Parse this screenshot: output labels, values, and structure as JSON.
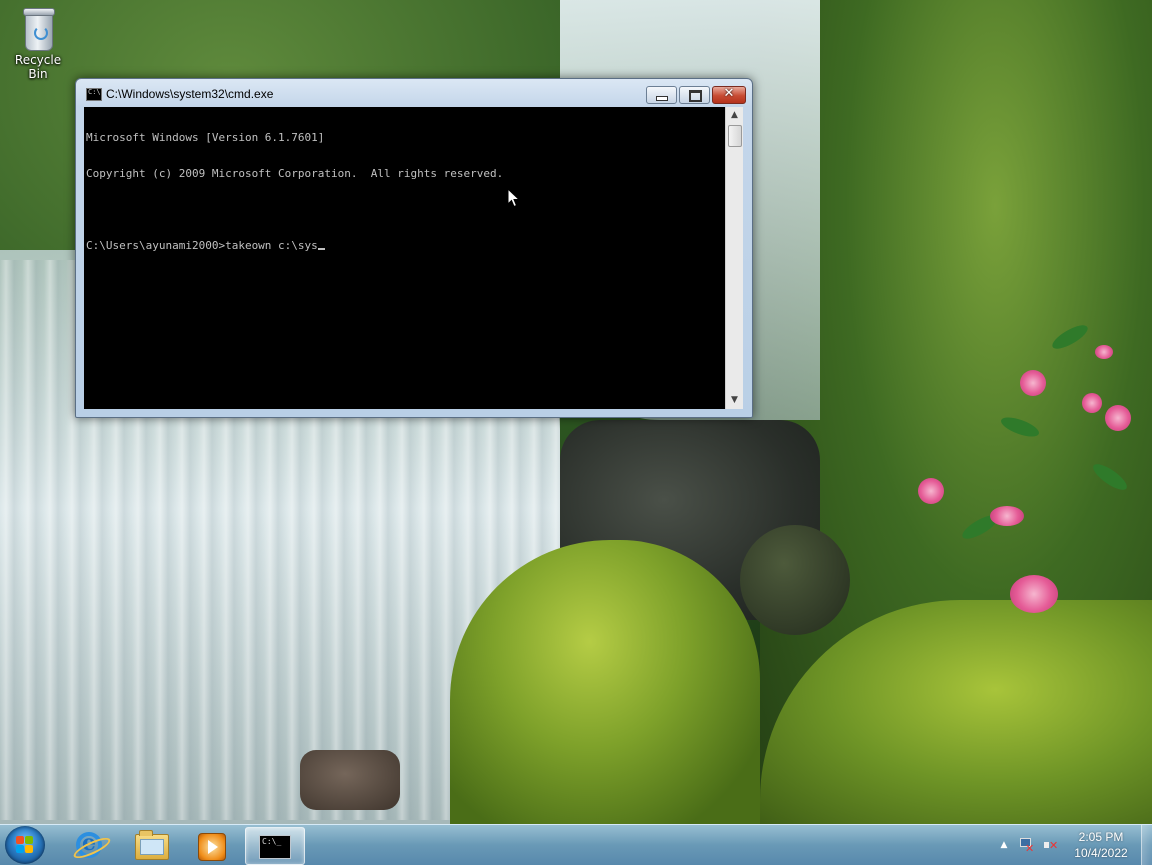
{
  "desktop": {
    "icons": [
      {
        "label": "Recycle Bin",
        "icon": "recycle-bin-icon"
      }
    ]
  },
  "cmd_window": {
    "title": "C:\\Windows\\system32\\cmd.exe",
    "lines": [
      "Microsoft Windows [Version 6.1.7601]",
      "Copyright (c) 2009 Microsoft Corporation.  All rights reserved.",
      "",
      "C:\\Users\\ayunami2000>takeown c:\\sys"
    ],
    "text_color": "#c0c0c0",
    "background_color": "#000000"
  },
  "taskbar": {
    "pinned": [
      {
        "name": "Internet Explorer",
        "icon": "internet-explorer-icon"
      },
      {
        "name": "Windows Explorer",
        "icon": "folder-icon"
      },
      {
        "name": "Windows Media Player",
        "icon": "media-player-icon"
      },
      {
        "name": "Command Prompt",
        "icon": "cmd-icon",
        "active": true
      }
    ],
    "clock": {
      "time": "2:05 PM",
      "date": "10/4/2022"
    }
  }
}
